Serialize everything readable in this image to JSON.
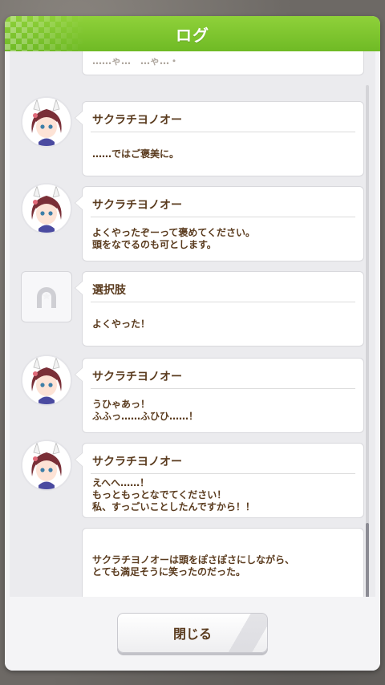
{
  "window": {
    "title": "ログ"
  },
  "log": {
    "partial_top_text": "……ゃ…　…ゃ…・",
    "entries": [
      {
        "speaker": "サクラチヨノオー",
        "lines": [
          "……ではご褒美に。"
        ],
        "icon": "sakura-chiyono-o-avatar"
      },
      {
        "speaker": "サクラチヨノオー",
        "lines": [
          "よくやったぞーって褒めてください。",
          "頭をなでるのも可とします。"
        ],
        "icon": "sakura-chiyono-o-avatar"
      },
      {
        "speaker": "選択肢",
        "lines": [
          "よくやった！"
        ],
        "icon": "choice-horseshoe-icon"
      },
      {
        "speaker": "サクラチヨノオー",
        "lines": [
          "うひゃあっ！",
          "ふふっ……ふひひ……！"
        ],
        "icon": "sakura-chiyono-o-avatar"
      },
      {
        "speaker": "サクラチヨノオー",
        "lines": [
          "えへへ……！",
          "もっともっとなでてください！",
          "私、すっごいことしたんですから！！"
        ],
        "icon": "sakura-chiyono-o-avatar"
      }
    ],
    "narration": {
      "lines": [
        "サクラチヨノオーは頭をぽさぽさにしながら、",
        "とても満足そうに笑ったのだった。"
      ]
    }
  },
  "footer": {
    "close_label": "閉じる"
  },
  "colors": {
    "title_green": "#7cc42f",
    "text_brown": "#5a3b1e",
    "hair": "#7a2f37",
    "ears": "#7a2f37"
  }
}
